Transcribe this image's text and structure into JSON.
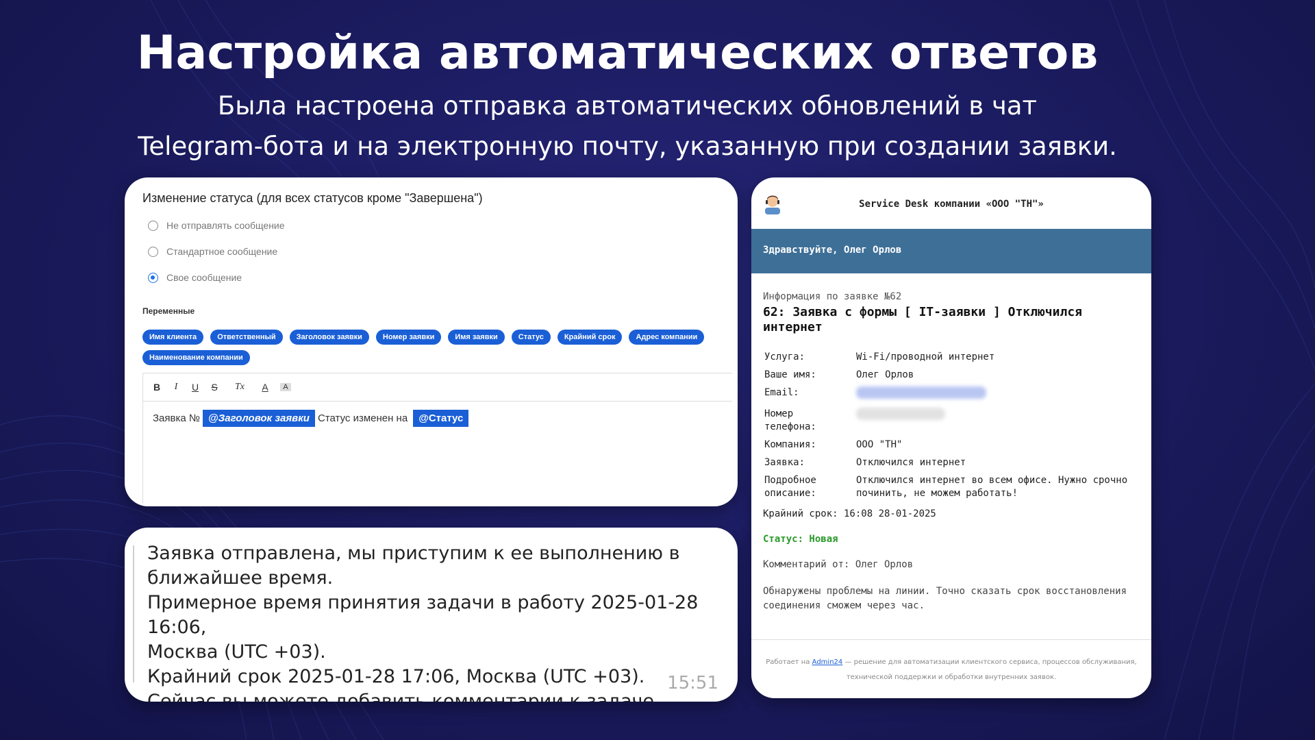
{
  "header": {
    "title": "Настройка автоматических ответов",
    "subtitle_line1": "Была настроена отправка автоматических обновлений в чат",
    "subtitle_line2": "Telegram-бота и на электронную почту, указанную при создании заявки."
  },
  "settings": {
    "title": "Изменение статуса (для всех статусов кроме \"Завершена\")",
    "options": [
      {
        "label": "Не отправлять сообщение",
        "selected": false
      },
      {
        "label": "Стандартное сообщение",
        "selected": false
      },
      {
        "label": "Свое сообщение",
        "selected": true
      }
    ],
    "variables_label": "Переменные",
    "variables": [
      "Имя клиента",
      "Ответственный",
      "Заголовок заявки",
      "Номер заявки",
      "Имя заявки",
      "Статус",
      "Крайний срок",
      "Адрес компании",
      "Наименование компании"
    ],
    "toolbar": [
      "B",
      "I",
      "U",
      "S",
      "Tx",
      "A",
      "A"
    ],
    "editor": {
      "text_before": "Заявка №",
      "tag1": "@Заголовок заявки",
      "text_middle": "Статус изменен на",
      "tag2": "@Статус"
    }
  },
  "telegram": {
    "lines": [
      "Заявка отправлена, мы приступим к ее выполнению в",
      "ближайшее время.",
      "Примерное время принятия задачи в работу 2025-01-28 16:06,",
      "Москва (UTC +03).",
      "Крайний срок 2025-01-28 17:06, Москва (UTC +03).",
      "Сейчас вы можете добавить комментарии к задаче."
    ],
    "time": "15:51"
  },
  "email": {
    "header_title": "Service Desk компании «ООО \"ТН\"»",
    "greeting": "Здравствуйте, Олег Орлов",
    "info_label": "Информация по заявке №62",
    "ticket_title": "62: Заявка с формы [ IT-заявки ] Отключился интернет",
    "fields": [
      {
        "label": "Услуга:",
        "value": "Wi-Fi/проводной интернет"
      },
      {
        "label": "Ваше имя:",
        "value": "Олег Орлов"
      },
      {
        "label": "Email:",
        "value": ""
      },
      {
        "label": "Номер телефона:",
        "value": ""
      },
      {
        "label": "Компания:",
        "value": "ООО \"ТН\""
      },
      {
        "label": "Заявка:",
        "value": "Отключился интернет"
      },
      {
        "label": "Подробное описание:",
        "value": "Отключился интернет во всем офисе. Нужно срочно починить, не можем работать!"
      }
    ],
    "deadline": "Крайний срок: 16:08 28-01-2025",
    "status": "Статус: Новая",
    "comment_by": "Комментарий от: Олег Орлов",
    "comment": "Обнаружены проблемы на линии. Точно сказать срок восстановления соединения сможем через час.",
    "footer_prefix": "Работает на",
    "footer_link": "Admin24",
    "footer_rest": "— решение для автоматизации клиентского сервиса, процессов обслуживания,",
    "footer_line2": "технической поддержки и обработки внутренних заявок.",
    "colors": {
      "band": "#3e6f97",
      "status": "#2a9a2a",
      "chip": "#1a5fd6"
    }
  }
}
